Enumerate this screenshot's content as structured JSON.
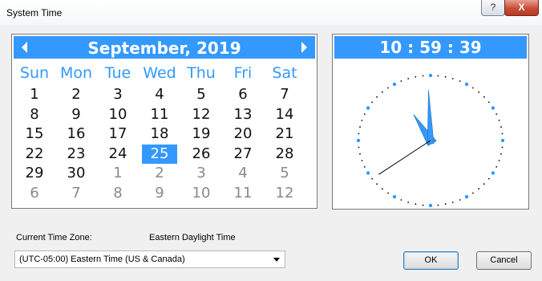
{
  "window": {
    "title": "System Time",
    "help_label": "?",
    "close_label": "X"
  },
  "calendar": {
    "month_label": "September, 2019",
    "day_names": [
      "Sun",
      "Mon",
      "Tue",
      "Wed",
      "Thu",
      "Fri",
      "Sat"
    ],
    "weeks": [
      [
        {
          "d": "1"
        },
        {
          "d": "2"
        },
        {
          "d": "3"
        },
        {
          "d": "4"
        },
        {
          "d": "5"
        },
        {
          "d": "6"
        },
        {
          "d": "7"
        }
      ],
      [
        {
          "d": "8"
        },
        {
          "d": "9"
        },
        {
          "d": "10"
        },
        {
          "d": "11"
        },
        {
          "d": "12"
        },
        {
          "d": "13"
        },
        {
          "d": "14"
        }
      ],
      [
        {
          "d": "15"
        },
        {
          "d": "16"
        },
        {
          "d": "17"
        },
        {
          "d": "18"
        },
        {
          "d": "19"
        },
        {
          "d": "20"
        },
        {
          "d": "21"
        }
      ],
      [
        {
          "d": "22"
        },
        {
          "d": "23"
        },
        {
          "d": "24"
        },
        {
          "d": "25",
          "selected": true
        },
        {
          "d": "26"
        },
        {
          "d": "27"
        },
        {
          "d": "28"
        }
      ],
      [
        {
          "d": "29"
        },
        {
          "d": "30"
        },
        {
          "d": "1",
          "other": true
        },
        {
          "d": "2",
          "other": true
        },
        {
          "d": "3",
          "other": true
        },
        {
          "d": "4",
          "other": true
        },
        {
          "d": "5",
          "other": true
        }
      ],
      [
        {
          "d": "6",
          "other": true
        },
        {
          "d": "7",
          "other": true
        },
        {
          "d": "8",
          "other": true
        },
        {
          "d": "9",
          "other": true
        },
        {
          "d": "10",
          "other": true
        },
        {
          "d": "11",
          "other": true
        },
        {
          "d": "12",
          "other": true
        }
      ]
    ],
    "selected_day": "25",
    "accent": "#3399ff"
  },
  "clock": {
    "time_text": "10 : 59 : 39",
    "hours": 10,
    "minutes": 59,
    "seconds": 39
  },
  "timezone": {
    "label": "Current Time Zone:",
    "value": "Eastern Daylight Time",
    "select_value": "(UTC-05:00) Eastern Time (US & Canada)"
  },
  "buttons": {
    "ok": "OK",
    "cancel": "Cancel"
  }
}
